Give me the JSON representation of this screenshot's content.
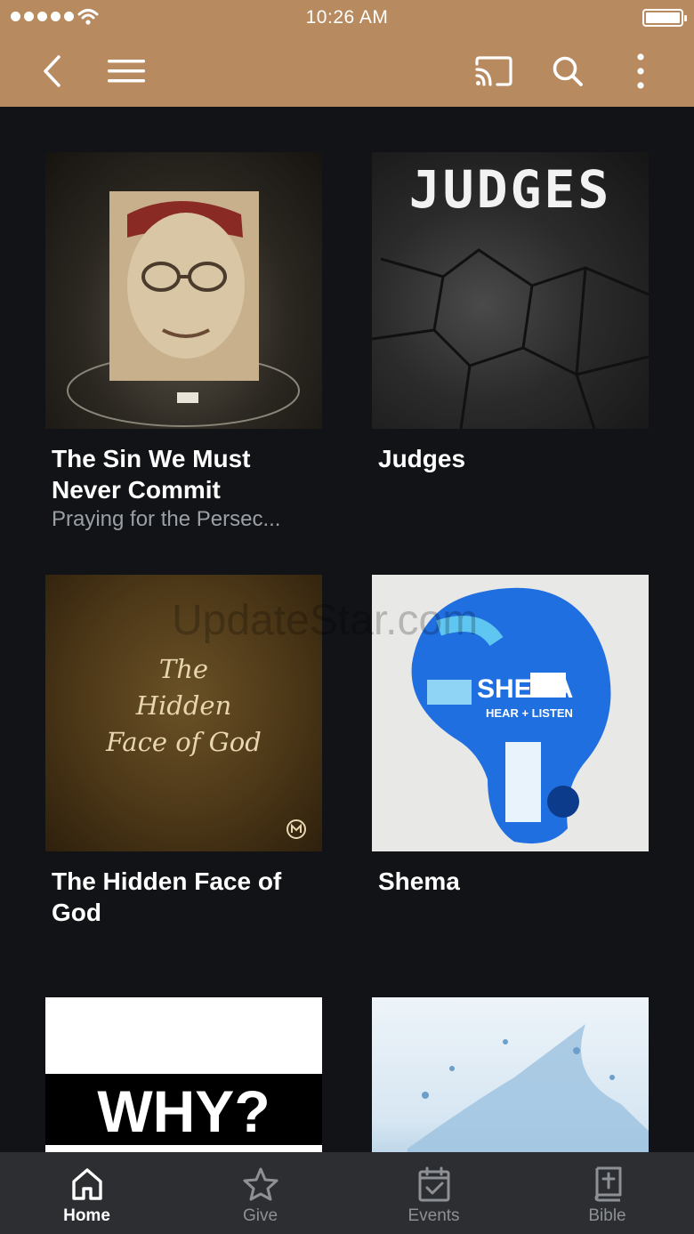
{
  "status_bar": {
    "time": "10:26 AM"
  },
  "app_bar": {
    "icons": [
      "back-icon",
      "menu-icon",
      "cast-icon",
      "search-icon",
      "more-vertical-icon"
    ]
  },
  "brand_color": "#b88a5f",
  "grid": {
    "items": [
      {
        "title": "The Sin We Must Never Commit",
        "subtitle": "Praying for the Persec..."
      },
      {
        "title": "Judges",
        "subtitle": ""
      },
      {
        "title": "The Hidden Face of God",
        "subtitle": ""
      },
      {
        "title": "Shema",
        "subtitle": ""
      },
      {
        "title": "",
        "subtitle": ""
      },
      {
        "title": "",
        "subtitle": ""
      }
    ],
    "thumb_text": {
      "judges": "JUDGES",
      "hidden_line1": "The",
      "hidden_line2": "Hidden",
      "hidden_line3": "Face of God",
      "shema": "SHEMA",
      "shema_sub": "HEAR + LISTEN",
      "why": "WHY?"
    }
  },
  "watermark": "UpdateStar.com",
  "tab_bar": {
    "tabs": [
      {
        "label": "Home",
        "icon": "home-icon",
        "active": true
      },
      {
        "label": "Give",
        "icon": "star-icon",
        "active": false
      },
      {
        "label": "Events",
        "icon": "calendar-check-icon",
        "active": false
      },
      {
        "label": "Bible",
        "icon": "bible-icon",
        "active": false
      }
    ]
  }
}
